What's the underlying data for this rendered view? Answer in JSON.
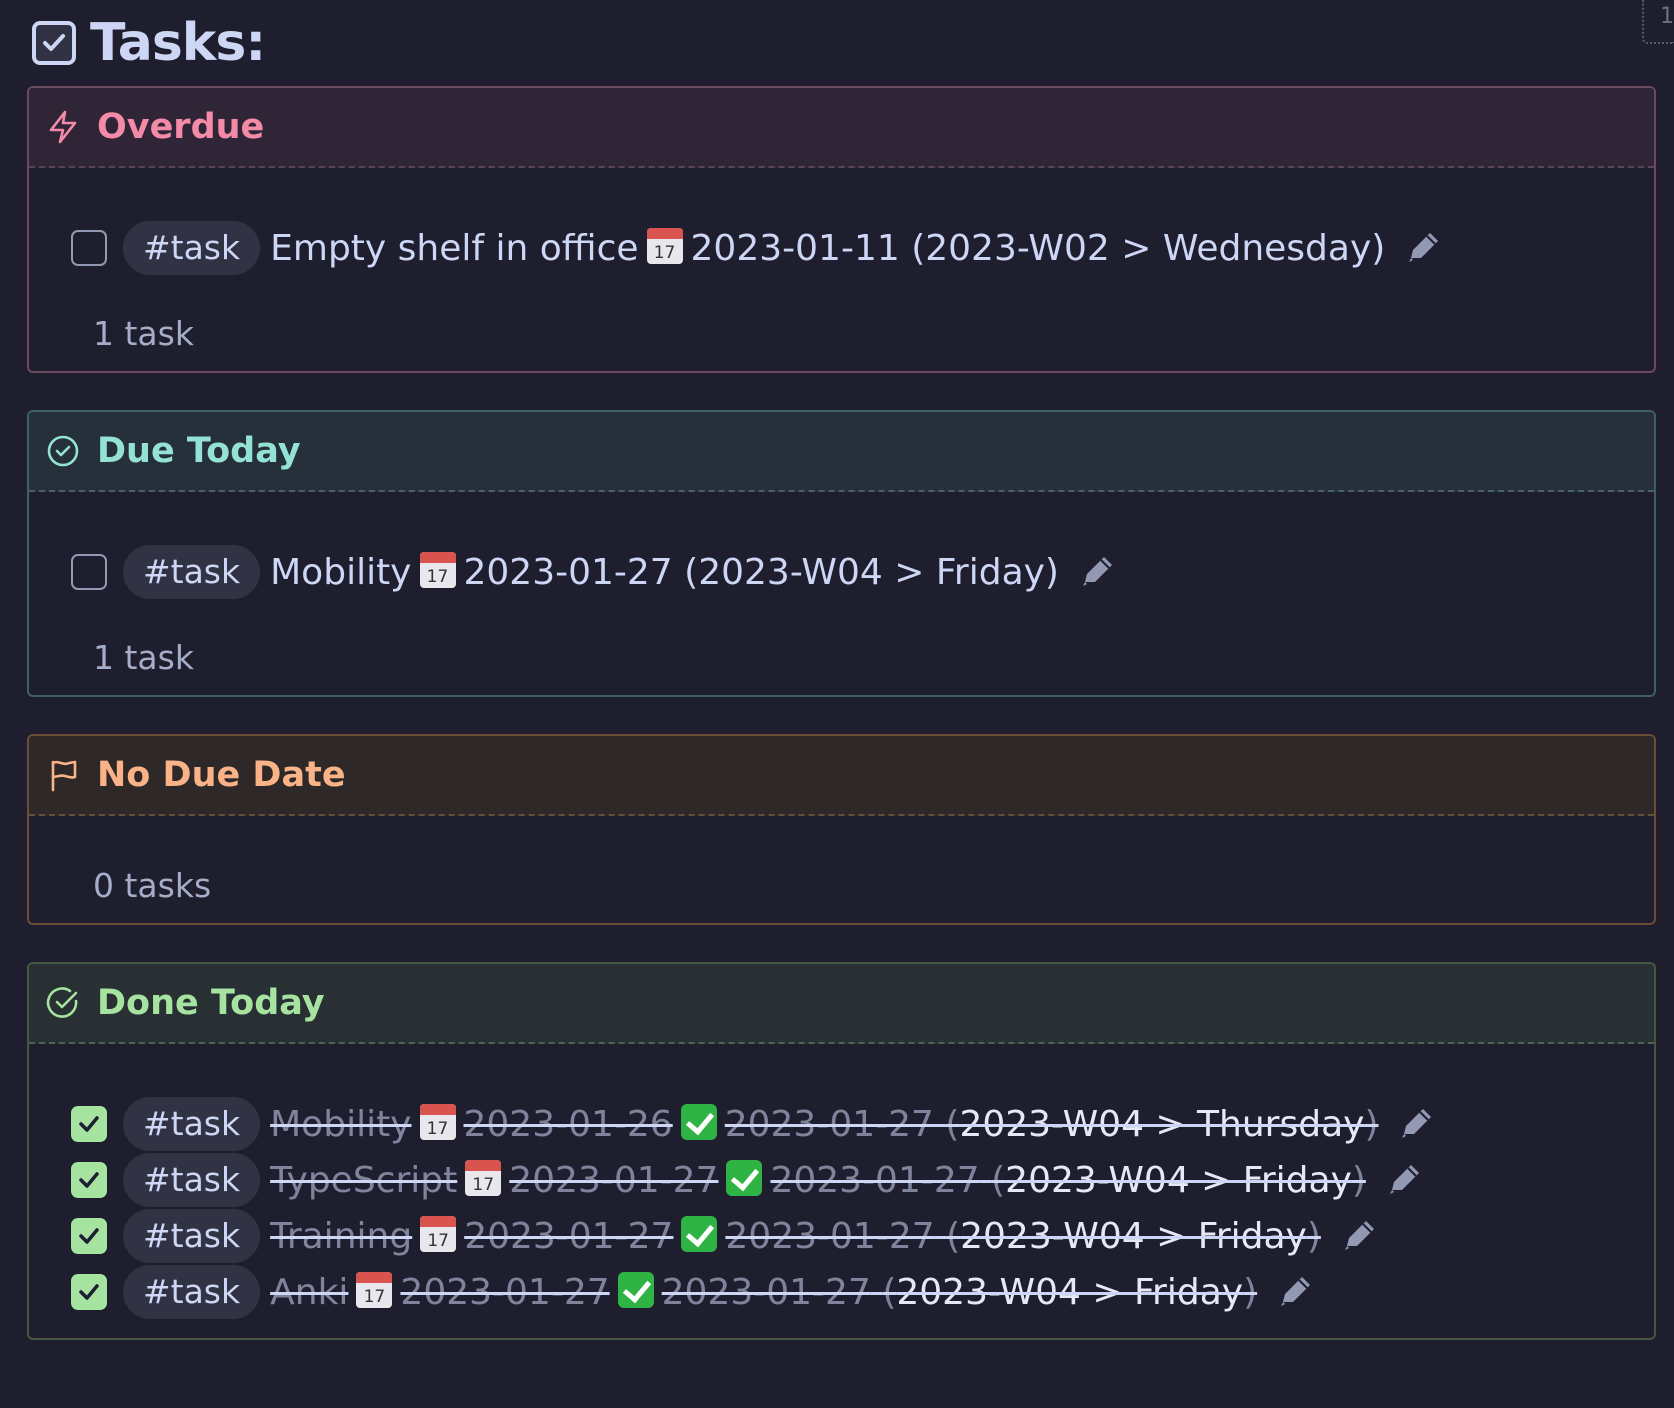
{
  "page": {
    "title": "Tasks:",
    "corner_mark": "1"
  },
  "sections": [
    {
      "title": "Overdue",
      "icon": "lightning-icon",
      "count": "1 task",
      "tasks": [
        {
          "tag": "#task",
          "text": "Empty shelf in office",
          "due_icon": "calendar-icon",
          "due": "2023-01-11",
          "week": "(2023-W02 > Wednesday)",
          "done": false
        }
      ]
    },
    {
      "title": "Due Today",
      "icon": "clock-check-icon",
      "count": "1 task",
      "tasks": [
        {
          "tag": "#task",
          "text": "Mobility",
          "due_icon": "calendar-icon",
          "due": "2023-01-27",
          "week": "(2023-W04 > Friday)",
          "done": false
        }
      ]
    },
    {
      "title": "No Due Date",
      "icon": "flag-icon",
      "count": "0 tasks",
      "tasks": []
    },
    {
      "title": "Done Today",
      "icon": "check-circle-icon",
      "tasks": [
        {
          "tag": "#task",
          "text": "Mobility",
          "due": "2023-01-26",
          "done_date": "2023-01-27",
          "week_open": "(",
          "week": "2023-W04 > Thursday",
          "week_close": ")",
          "done": true
        },
        {
          "tag": "#task",
          "text": "TypeScript",
          "due": "2023-01-27",
          "done_date": "2023-01-27",
          "week_open": "(",
          "week": "2023-W04 > Friday",
          "week_close": ")",
          "done": true
        },
        {
          "tag": "#task",
          "text": "Training",
          "due": "2023-01-27",
          "done_date": "2023-01-27",
          "week_open": "(",
          "week": "2023-W04 > Friday",
          "week_close": ")",
          "done": true
        },
        {
          "tag": "#task",
          "text": "Anki",
          "due": "2023-01-27",
          "done_date": "2023-01-27",
          "week_open": "(",
          "week": "2023-W04 > Friday",
          "week_close": ")",
          "done": true
        }
      ]
    }
  ],
  "icons": {
    "calendar_day": "17"
  },
  "colors": {
    "overdue": "#f38ba8",
    "due_today": "#94e2d5",
    "no_due_date": "#fab387",
    "done_today": "#a6e3a1"
  }
}
